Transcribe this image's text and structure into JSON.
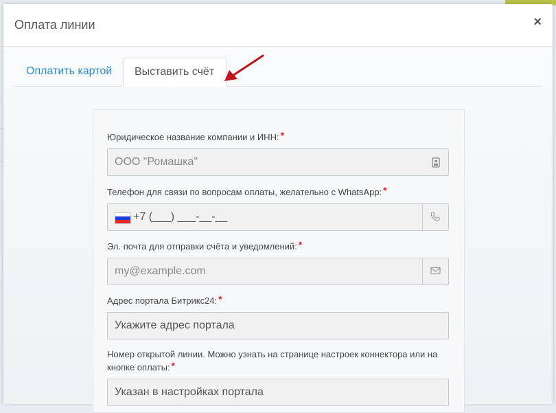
{
  "modal": {
    "title": "Оплата линии",
    "close_glyph": "×"
  },
  "tabs": [
    {
      "label": "Оплатить картой",
      "active": false
    },
    {
      "label": "Выставить счёт",
      "active": true
    }
  ],
  "colors": {
    "link": "#2a8dd4",
    "required": "#e41f2d",
    "arrow": "#c0141a"
  },
  "form": {
    "required_mark": "*",
    "company": {
      "label": "Юридическое название компании и ИНН:",
      "placeholder": "ООО \"Ромашка\"",
      "icon": "contact-card-icon"
    },
    "phone": {
      "label": "Телефон для связи по вопросам оплаты, желательно с WhatsApp:",
      "mask": "+7 (___) ___-__-__",
      "flag": "russia-flag-icon",
      "icon": "phone-icon"
    },
    "email": {
      "label": "Эл. почта для отправки счёта и уведомлений:",
      "placeholder": "my@example.com",
      "icon": "envelope-icon"
    },
    "portal": {
      "label": "Адрес портала Битрикс24:",
      "placeholder": "Укажите адрес портала"
    },
    "line": {
      "label": "Номер открытой линии. Можно узнать на странице настроек коннектора или на кнопке оплаты:",
      "placeholder": "Указан в настройках портала"
    }
  }
}
